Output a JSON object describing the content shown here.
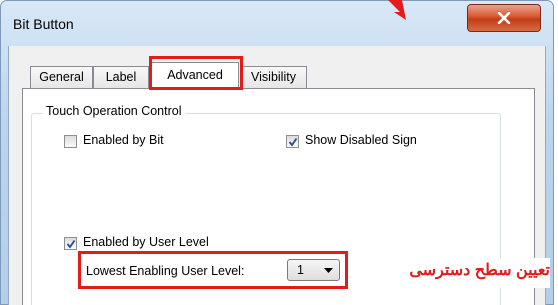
{
  "window": {
    "title": "Bit Button",
    "close_icon": "close-x-icon"
  },
  "tabs": [
    {
      "label": "General",
      "active": false
    },
    {
      "label": "Label",
      "active": false
    },
    {
      "label": "Advanced",
      "active": true
    },
    {
      "label": "Visibility",
      "active": false
    }
  ],
  "touch_group": {
    "title": "Touch Operation Control",
    "enabled_by_bit": {
      "label": "Enabled by Bit",
      "checked": false
    },
    "show_disabled_sign": {
      "label": "Show Disabled Sign",
      "checked": true
    },
    "enabled_by_user_level": {
      "label": "Enabled by User Level",
      "checked": true
    },
    "lowest_level_label": "Lowest Enabling User Level:",
    "lowest_level_value": "1"
  },
  "annotation": {
    "text": "تعیین سطح دسترسی",
    "color": "#e21b1b"
  },
  "colors": {
    "highlight": "#e21b1b",
    "titlebar": "#bcd4ee",
    "close_button": "#c13d17"
  }
}
